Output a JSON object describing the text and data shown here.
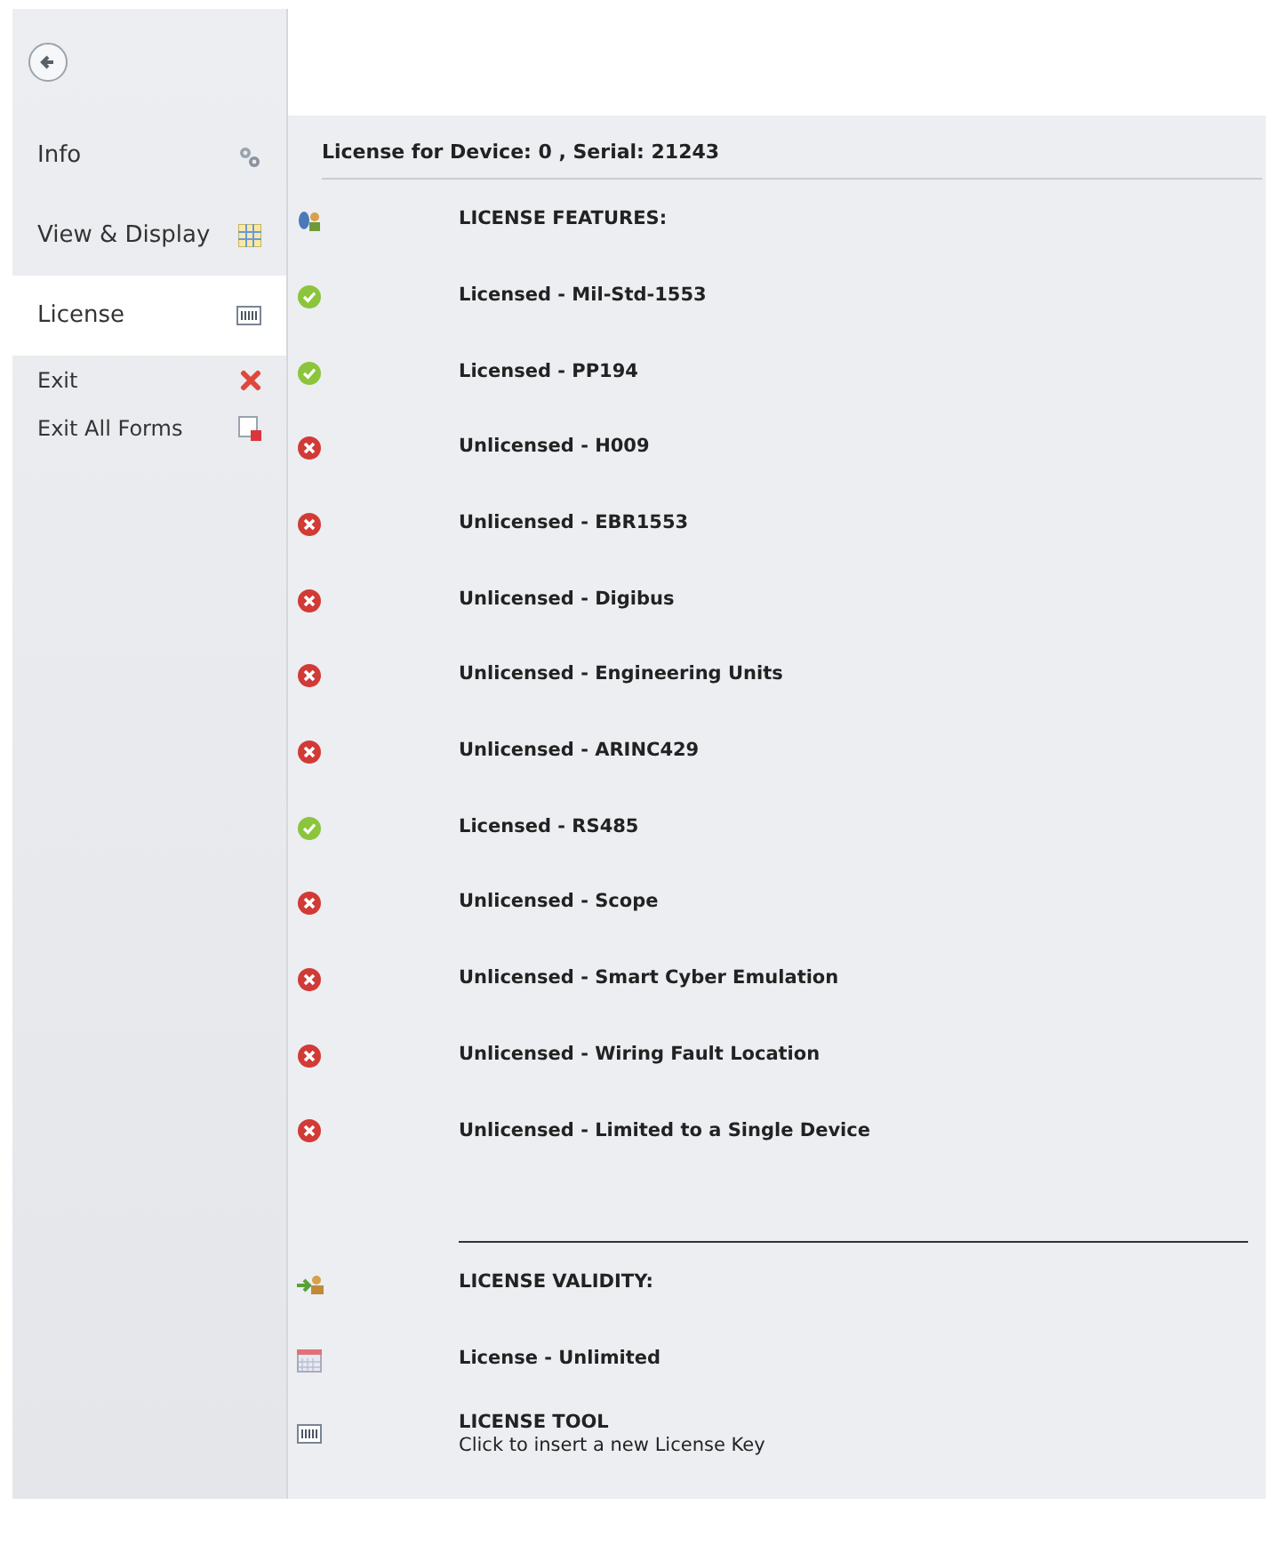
{
  "sidebar": {
    "items": [
      {
        "label": "Info",
        "kind": "page",
        "selected": false
      },
      {
        "label": "View & Display",
        "kind": "page",
        "selected": false
      },
      {
        "label": "License",
        "kind": "page",
        "selected": true
      },
      {
        "label": "Exit",
        "kind": "command",
        "selected": false
      },
      {
        "label": "Exit All Forms",
        "kind": "command",
        "selected": false
      }
    ]
  },
  "header": {
    "title": "License for Device: 0 , Serial: 21243"
  },
  "features": {
    "title": "LICENSE FEATURES:",
    "items": [
      {
        "label": "Licensed - Mil-Std-1553",
        "licensed": true
      },
      {
        "label": "Licensed - PP194",
        "licensed": true
      },
      {
        "label": "Unlicensed - H009",
        "licensed": false
      },
      {
        "label": "Unlicensed - EBR1553",
        "licensed": false
      },
      {
        "label": "Unlicensed - Digibus",
        "licensed": false
      },
      {
        "label": "Unlicensed - Engineering Units",
        "licensed": false
      },
      {
        "label": "Unlicensed - ARINC429",
        "licensed": false
      },
      {
        "label": "Licensed - RS485",
        "licensed": true
      },
      {
        "label": "Unlicensed - Scope",
        "licensed": false
      },
      {
        "label": "Unlicensed - Smart Cyber Emulation",
        "licensed": false
      },
      {
        "label": "Unlicensed - Wiring Fault Location",
        "licensed": false
      },
      {
        "label": "Unlicensed - Limited to a Single Device",
        "licensed": false
      }
    ]
  },
  "validity": {
    "title": "LICENSE VALIDITY:",
    "value": "License - Unlimited"
  },
  "tool": {
    "title": "LICENSE TOOL",
    "description": "Click to insert a new License Key"
  }
}
